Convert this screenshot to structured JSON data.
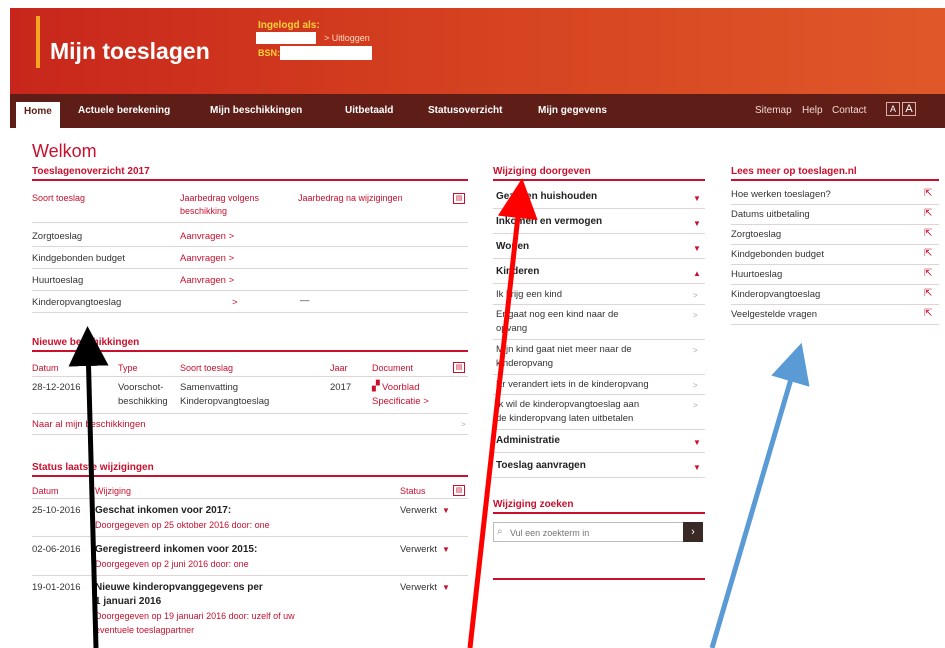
{
  "header": {
    "app_title": "Mijn toeslagen",
    "logged_in_label": "Ingelogd als:",
    "logout_label": "> Uitloggen",
    "bsn_label": "BSN:"
  },
  "nav": {
    "tabs": [
      "Home",
      "Actuele berekening",
      "Mijn beschikkingen",
      "Uitbetaald",
      "Statusoverzicht",
      "Mijn gegevens"
    ],
    "utility": [
      "Sitemap",
      "Help",
      "Contact"
    ],
    "font_small": "A",
    "font_large": "A"
  },
  "welcome": "Welkom",
  "overview": {
    "title": "Toeslagenoverzicht 2017",
    "col1": "Soort toeslag",
    "col2a": "Jaarbedrag volgens",
    "col2b": "beschikking",
    "col3": "Jaarbedrag na wijzigingen",
    "rows": [
      {
        "name": "Zorgtoeslag",
        "action": "Aanvragen >"
      },
      {
        "name": "Kindgebonden budget",
        "action": "Aanvragen >"
      },
      {
        "name": "Huurtoeslag",
        "action": "Aanvragen >"
      },
      {
        "name": "Kinderopvangtoeslag",
        "action": ">",
        "after": "—"
      }
    ]
  },
  "decisions": {
    "title": "Nieuwe beschikkingen",
    "headers": [
      "Datum",
      "Type",
      "Soort toeslag",
      "Jaar",
      "Document"
    ],
    "row": {
      "date": "28-12-2016",
      "type1": "Voorschot-",
      "type2": "beschikking",
      "kind1": "Samenvatting",
      "kind2": "Kinderopvangtoeslag",
      "year": "2017",
      "doc1": "Voorblad",
      "doc2": "Specificatie >"
    },
    "all_link": "Naar al mijn beschikkingen"
  },
  "status": {
    "title": "Status laatste wijzigingen",
    "headers": [
      "Datum",
      "Wijziging",
      "Status"
    ],
    "rows": [
      {
        "date": "25-10-2016",
        "title": "Geschat inkomen voor 2017:",
        "sub": "Doorgegeven op 25 oktober 2016 door: one",
        "status": "Verwerkt"
      },
      {
        "date": "02-06-2016",
        "title": "Geregistreerd inkomen voor 2015:",
        "sub": "Doorgegeven op 2 juni 2016 door: one",
        "status": "Verwerkt"
      },
      {
        "date": "19-01-2016",
        "title1": "Nieuwe kinderopvanggegevens per",
        "title2": "1 januari 2016",
        "sub1": "Doorgegeven op 19 januari 2016 door: uzelf of uw",
        "sub2": "eventuele toeslagpartner",
        "status": "Verwerkt"
      }
    ]
  },
  "changes": {
    "title": "Wijziging doorgeven",
    "categories": [
      "Gezin en huishouden",
      "Inkomen en vermogen",
      "Wonen",
      "Kinderen"
    ],
    "kids_items": [
      {
        "l1": "Ik krijg een kind"
      },
      {
        "l1": "Er gaat nog een kind naar de",
        "l2": "opvang"
      },
      {
        "l1": "Mijn kind gaat niet meer naar de",
        "l2": "kinderopvang"
      },
      {
        "l1": "Er verandert iets in de kinderopvang"
      },
      {
        "l1": "Ik wil de kinderopvangtoeslag aan",
        "l2": "de kinderopvang laten uitbetalen"
      }
    ],
    "more": [
      "Administratie",
      "Toeslag aanvragen"
    ],
    "search_title": "Wijziging zoeken",
    "search_placeholder": "Vul een zoekterm in"
  },
  "readmore": {
    "title": "Lees meer op toeslagen.nl",
    "links": [
      "Hoe werken toeslagen?",
      "Datums uitbetaling",
      "Zorgtoeslag",
      "Kindgebonden budget",
      "Huurtoeslag",
      "Kinderopvangtoeslag",
      "Veelgestelde vragen"
    ]
  },
  "colors": {
    "brand_red": "#c8102e",
    "nav_dark": "#5e1e17",
    "arrow_black": "#000000",
    "arrow_red": "#ff0000",
    "arrow_blue": "#5b9bd5"
  }
}
